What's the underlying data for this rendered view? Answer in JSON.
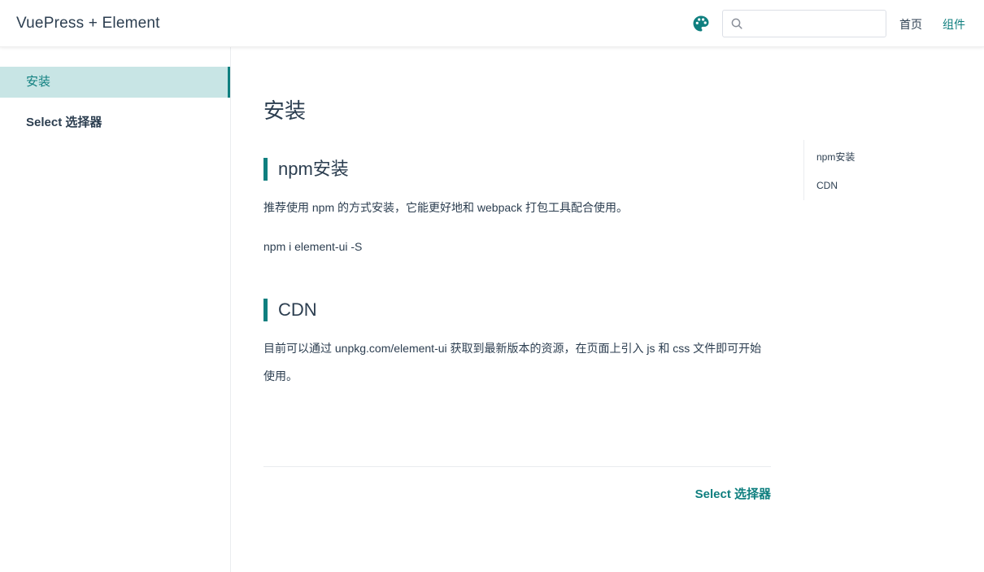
{
  "navbar": {
    "site_title": "VuePress + Element",
    "theme_icon": "palette-icon",
    "search": {
      "value": "",
      "placeholder": "",
      "icon": "search-icon"
    },
    "links": [
      {
        "label": "首页",
        "active": false
      },
      {
        "label": "组件",
        "active": true
      }
    ]
  },
  "sidebar": {
    "items": [
      {
        "label": "安装",
        "active": true
      },
      {
        "label": "Select 选择器",
        "active": false
      }
    ]
  },
  "page": {
    "title": "安装",
    "sections": [
      {
        "heading": "npm安装",
        "paragraphs": [
          "推荐使用 npm 的方式安装，它能更好地和 webpack 打包工具配合使用。",
          "npm i element-ui -S"
        ]
      },
      {
        "heading": "CDN",
        "paragraphs": [
          "目前可以通过 unpkg.com/element-ui 获取到最新版本的资源，在页面上引入 js 和 css 文件即可开始使用。"
        ]
      }
    ],
    "next_link": "Select 选择器"
  },
  "toc": {
    "items": [
      "npm安装",
      "CDN"
    ]
  },
  "colors": {
    "accent": "#0f7f7f",
    "active_bg": "#c8e5e5",
    "text": "#2c3e50"
  }
}
